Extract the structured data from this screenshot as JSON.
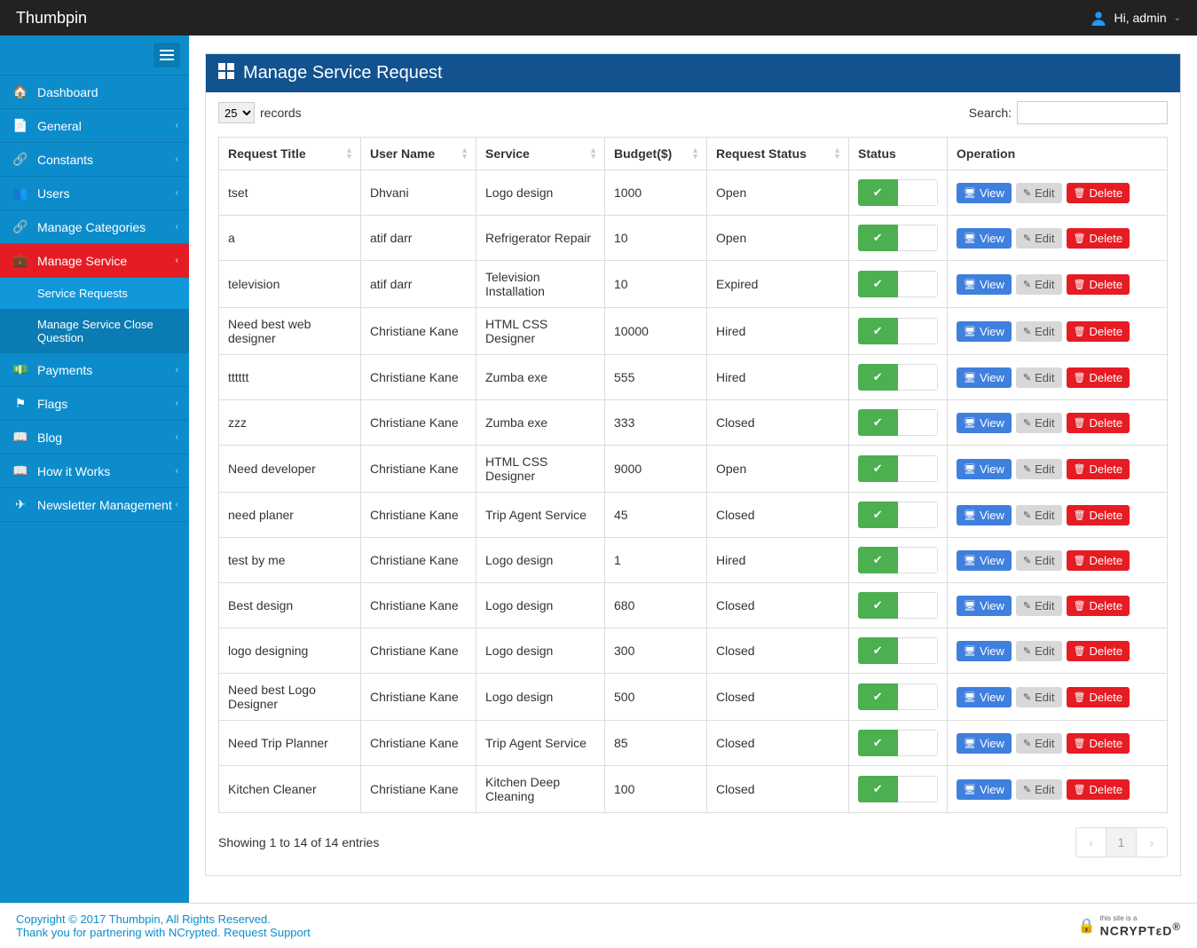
{
  "brand": "Thumbpin",
  "user": {
    "greeting": "Hi, admin"
  },
  "sidebar": {
    "items": [
      {
        "icon": "home",
        "label": "Dashboard",
        "expandable": false
      },
      {
        "icon": "file",
        "label": "General",
        "expandable": true
      },
      {
        "icon": "sitemap",
        "label": "Constants",
        "expandable": true
      },
      {
        "icon": "users",
        "label": "Users",
        "expandable": true
      },
      {
        "icon": "sitemap",
        "label": "Manage Categories",
        "expandable": true
      },
      {
        "icon": "briefcase",
        "label": "Manage Service",
        "expandable": true,
        "active": true,
        "children": [
          {
            "label": "Service Requests",
            "active": true
          },
          {
            "label": "Manage Service Close Question"
          }
        ]
      },
      {
        "icon": "money",
        "label": "Payments",
        "expandable": true
      },
      {
        "icon": "flag",
        "label": "Flags",
        "expandable": true
      },
      {
        "icon": "book",
        "label": "Blog",
        "expandable": true
      },
      {
        "icon": "book",
        "label": "How it Works",
        "expandable": true
      },
      {
        "icon": "send",
        "label": "Newsletter Management",
        "expandable": true
      }
    ]
  },
  "panel": {
    "title": "Manage Service Request"
  },
  "records": {
    "selected": "25",
    "label": "records"
  },
  "search": {
    "label": "Search:",
    "value": ""
  },
  "columns": [
    "Request Title",
    "User Name",
    "Service",
    "Budget($)",
    "Request Status",
    "Status",
    "Operation"
  ],
  "buttons": {
    "view": "View",
    "edit": "Edit",
    "delete": "Delete"
  },
  "rows": [
    {
      "title": "tset",
      "user": "Dhvani",
      "service": "Logo design",
      "budget": "1000",
      "reqstatus": "Open"
    },
    {
      "title": "a",
      "user": "atif darr",
      "service": "Refrigerator Repair",
      "budget": "10",
      "reqstatus": "Open"
    },
    {
      "title": "television",
      "user": "atif darr",
      "service": "Television Installation",
      "budget": "10",
      "reqstatus": "Expired"
    },
    {
      "title": "Need best web designer",
      "user": "Christiane Kane",
      "service": "HTML CSS Designer",
      "budget": "10000",
      "reqstatus": "Hired"
    },
    {
      "title": "tttttt",
      "user": "Christiane Kane",
      "service": "Zumba exe",
      "budget": "555",
      "reqstatus": "Hired"
    },
    {
      "title": "zzz",
      "user": "Christiane Kane",
      "service": "Zumba exe",
      "budget": "333",
      "reqstatus": "Closed"
    },
    {
      "title": "Need developer",
      "user": "Christiane Kane",
      "service": "HTML CSS Designer",
      "budget": "9000",
      "reqstatus": "Open"
    },
    {
      "title": "need planer",
      "user": "Christiane Kane",
      "service": "Trip Agent Service",
      "budget": "45",
      "reqstatus": "Closed"
    },
    {
      "title": "test by me",
      "user": "Christiane Kane",
      "service": "Logo design",
      "budget": "1",
      "reqstatus": "Hired"
    },
    {
      "title": "Best design",
      "user": "Christiane Kane",
      "service": "Logo design",
      "budget": "680",
      "reqstatus": "Closed"
    },
    {
      "title": "logo designing",
      "user": "Christiane Kane",
      "service": "Logo design",
      "budget": "300",
      "reqstatus": "Closed"
    },
    {
      "title": "Need best Logo Designer",
      "user": "Christiane Kane",
      "service": "Logo design",
      "budget": "500",
      "reqstatus": "Closed"
    },
    {
      "title": "Need Trip Planner",
      "user": "Christiane Kane",
      "service": "Trip Agent Service",
      "budget": "85",
      "reqstatus": "Closed"
    },
    {
      "title": "Kitchen Cleaner",
      "user": "Christiane Kane",
      "service": "Kitchen Deep Cleaning",
      "budget": "100",
      "reqstatus": "Closed"
    }
  ],
  "info": "Showing 1 to 14 of 14 entries",
  "pagination": {
    "current": "1"
  },
  "footer": {
    "copyright": "Copyright © 2017 Thumbpin, All Rights Reserved.",
    "thanks_prefix": "Thank you for partnering with ",
    "ncrypted": "NCrypted",
    "sep": ". ",
    "support": "Request Support",
    "badge_small": "this site is a",
    "badge": "NCRYPTεD",
    "reg": "®"
  }
}
